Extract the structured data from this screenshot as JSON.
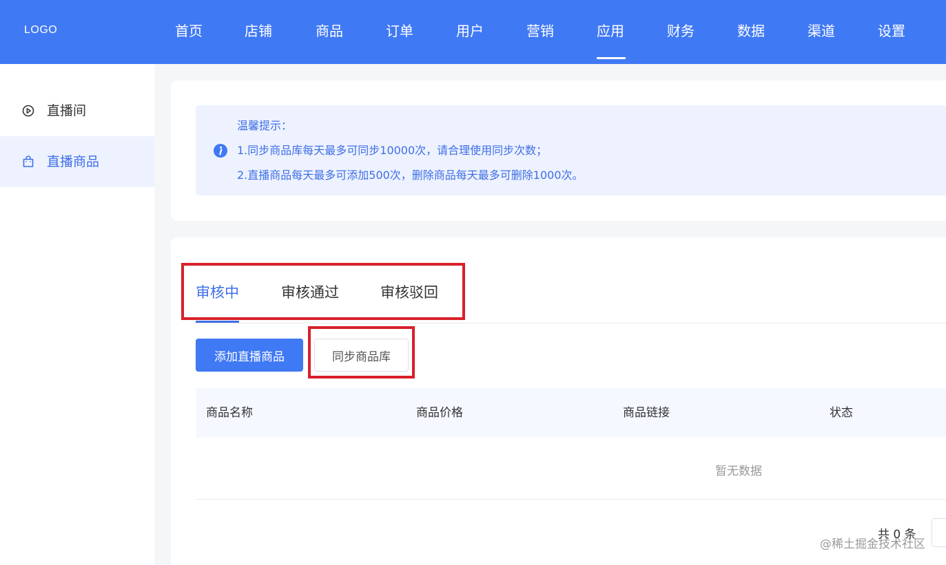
{
  "header": {
    "logo": "LOGO",
    "nav": [
      "首页",
      "店铺",
      "商品",
      "订单",
      "用户",
      "营销",
      "应用",
      "财务",
      "数据",
      "渠道",
      "设置"
    ],
    "active_nav": "应用"
  },
  "sidebar": {
    "items": [
      {
        "label": "直播间",
        "icon": "play-circle-icon"
      },
      {
        "label": "直播商品",
        "icon": "shopping-bag-icon"
      }
    ],
    "active": "直播商品"
  },
  "notice": {
    "title": "温馨提示：",
    "line1": "1.同步商品库每天最多可同步10000次，请合理使用同步次数；",
    "line2": "2.直播商品每天最多可添加500次，删除商品每天最多可删除1000次。",
    "icon": "info-icon"
  },
  "tabs": {
    "items": [
      "审核中",
      "审核通过",
      "审核驳回"
    ],
    "active": "审核中"
  },
  "actions": {
    "add_label": "添加直播商品",
    "sync_label": "同步商品库"
  },
  "table": {
    "columns": [
      "商品名称",
      "商品价格",
      "商品链接",
      "状态"
    ],
    "empty_text": "暂无数据"
  },
  "pagination": {
    "total_text": "共 0 条"
  },
  "watermark": "@稀土掘金技术社区",
  "colors": {
    "primary": "#4079f4",
    "highlight": "#d8202a",
    "notice_bg": "#edf2fe"
  }
}
